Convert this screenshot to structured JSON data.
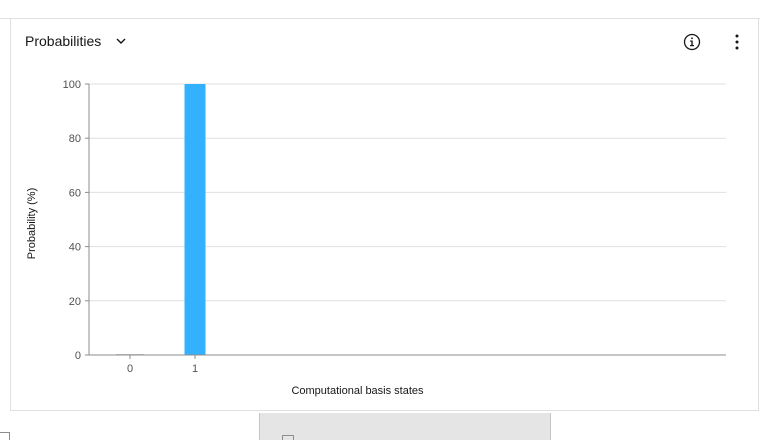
{
  "card": {
    "view_label": "Probabilities",
    "dropdown_icon": "chevron-down-icon",
    "info_icon": "information-icon",
    "overflow_icon": "overflow-menu-vertical-icon"
  },
  "chart_data": {
    "type": "bar",
    "categories": [
      "0",
      "1"
    ],
    "values": [
      0,
      100
    ],
    "xlabel": "Computational basis states",
    "ylabel": "Probability (%)",
    "ylim": [
      0,
      100
    ],
    "yticks": [
      0,
      20,
      40,
      60,
      80,
      100
    ],
    "grid": true,
    "bar_color": "#33b1ff",
    "axis_color": "#8d8d8d",
    "grid_color": "#e0e0e0"
  }
}
